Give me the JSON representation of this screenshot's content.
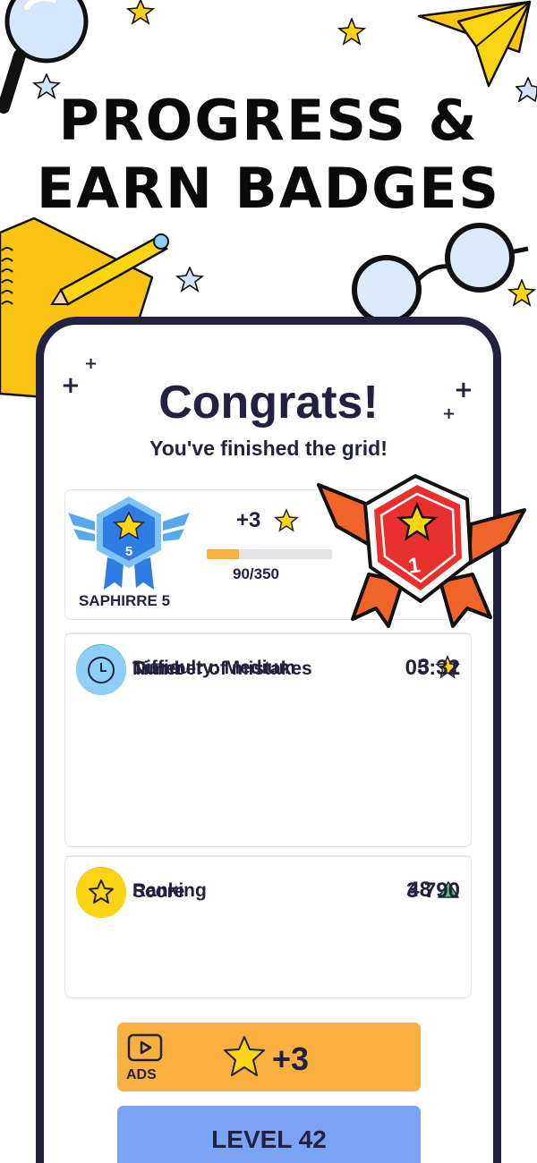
{
  "headline": {
    "line1": "PROGRESS &",
    "line2": "EARN BADGES"
  },
  "result": {
    "title": "Congrats!",
    "subtitle": "You've finished the grid!"
  },
  "badge": {
    "current_level": "5",
    "name": "SAPHIRRE 5",
    "gain": "+3",
    "progress_text": "90/350",
    "progress_fraction": 0.257,
    "ranking_badge_level": "1"
  },
  "stats": [
    {
      "label": "Difficulty: Medium",
      "value": "3",
      "icon": "difficulty-chart-icon",
      "icon_bg": "#34c1b0"
    },
    {
      "label": "Number of mistakes",
      "value": "2",
      "icon": "mistake-x-icon",
      "icon_bg": "#f4989b"
    },
    {
      "label": "Timer",
      "value": "05:31",
      "icon": "clock-icon",
      "icon_bg": "#8ecff6"
    }
  ],
  "ranking": [
    {
      "label": "Ranking",
      "value": "48",
      "icon": "trophy-icon",
      "icon_bg": "#f9b040"
    },
    {
      "label": "Score",
      "value": "3 790",
      "icon": "star-icon",
      "icon_bg": "#fbd414"
    }
  ],
  "buttons": {
    "ads_label": "ADS",
    "ads_reward": "+3",
    "level_label": "LEVEL 42"
  },
  "colors": {
    "dark": "#232140",
    "orange": "#f9b040",
    "blue_button": "#7aa4f3",
    "badge_blue": "#2f7de3",
    "badge_red": "#e8312f",
    "star_yellow": "#fbd414",
    "up_arrow_green": "#56c271"
  }
}
